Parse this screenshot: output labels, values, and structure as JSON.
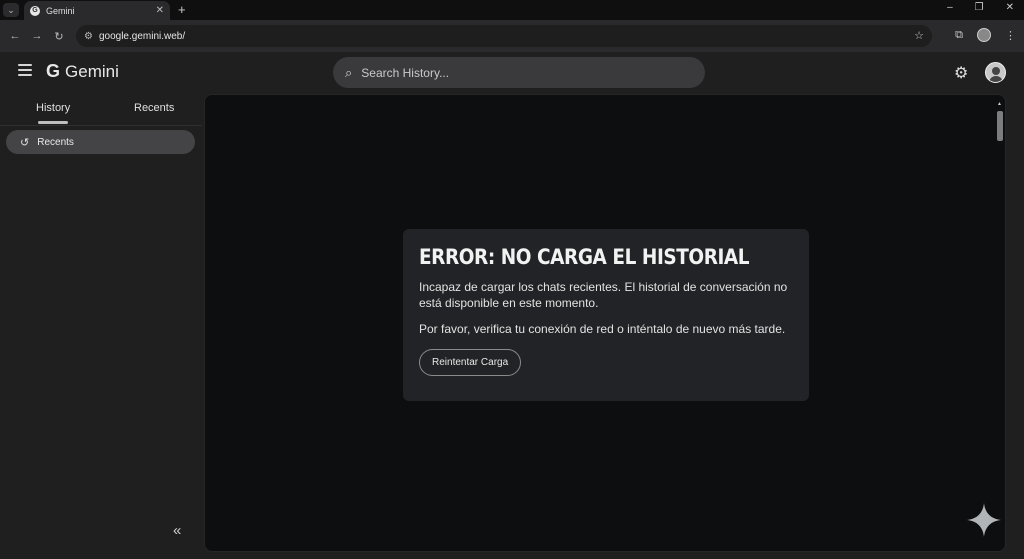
{
  "browser": {
    "tab_title": "Gemini",
    "tab_favicon_letter": "G",
    "url": "google.gemini.web/"
  },
  "header": {
    "brand_letter": "G",
    "brand_name": "Gemini",
    "search_placeholder": "Search History..."
  },
  "sidebar": {
    "tabs": [
      {
        "label": "History",
        "active": true
      },
      {
        "label": "Recents",
        "active": false
      }
    ],
    "items": [
      {
        "label": "Recents",
        "icon": "history-icon",
        "selected": true
      }
    ]
  },
  "error": {
    "title": "ERROR: NO CARGA EL HISTORIAL",
    "message": "Incapaz de cargar los chats recientes. El historial de conversación no está disponible en este momento.",
    "hint": "Por favor, verifica tu conexión de red o inténtalo de nuevo más tarde.",
    "retry_label": "Reintentar Carga"
  },
  "colors": {
    "background": "#1f1f1f",
    "panel": "#0d0e10",
    "card": "#222326",
    "search": "#3a3a3c",
    "selected_item": "#444446"
  }
}
